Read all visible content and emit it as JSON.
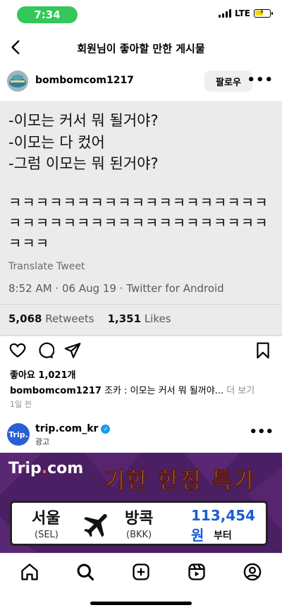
{
  "status_bar": {
    "time": "7:34",
    "network": "LTE",
    "battery_level": 0.55
  },
  "nav": {
    "title": "회원님이 좋아할 만한 게시물"
  },
  "post": {
    "username": "bombomcom1217",
    "follow_label": "팔로우",
    "tweet": {
      "lines": [
        "-이모는 커서 뭐 될거야?",
        "-이모는 다 컸어",
        "-그럼 이모는 뭐 된거야?"
      ],
      "laugh_lines": [
        "ㅋㅋㅋㅋㅋㅋㅋㅋㅋㅋㅋㅋㅋㅋㅋㅋㅋㅋㅋ",
        "ㅋㅋㅋㅋㅋㅋㅋㅋㅋㅋㅋㅋㅋㅋㅋㅋㅋㅋㅋ",
        "ㅋㅋㅋ"
      ],
      "translate": "Translate Tweet",
      "meta": "8:52 AM · 06 Aug 19 · Twitter for Android",
      "retweets_count": "5,068",
      "retweets_label": "Retweets",
      "likes_count": "1,351",
      "likes_label": "Likes"
    },
    "likes": "좋아요 1,021개",
    "caption_user": "bombomcom1217",
    "caption_text": " 조카 : 이모는 커서 뭐 될꺼야...",
    "caption_more": " 더 보기",
    "time_ago": "1일 전"
  },
  "ad": {
    "avatar_text": "Trip.",
    "name": "trip.com_kr",
    "label": "광고",
    "brand": "Trip",
    "brand_dot": ".",
    "brand_suffix": "com",
    "headline": "기한 한정 특가",
    "from_city": "서울",
    "from_code": "(SEL)",
    "to_city": "방콕",
    "to_code": "(BKK)",
    "price": "113,454원",
    "price_suffix": "부터"
  },
  "colors": {
    "accent_green": "#34c759",
    "banner_bg": "#4b1f63",
    "headline": "#ffb41e",
    "price": "#1a5bd8"
  },
  "icons": [
    "back-arrow-icon",
    "heart-icon",
    "comment-icon",
    "share-icon",
    "bookmark-icon",
    "home-icon",
    "search-icon",
    "create-icon",
    "reels-icon",
    "profile-icon",
    "more-icon",
    "verified-icon",
    "airplane-icon"
  ]
}
